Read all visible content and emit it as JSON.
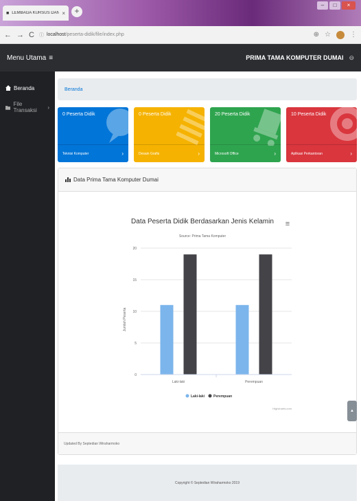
{
  "browser": {
    "tab_title": "LEMBAGA KURSUS DAN PELATI",
    "tab_close": "×",
    "new_tab": "+",
    "url_host": "localhost",
    "url_path": "/peserta-didik/file/index.php"
  },
  "header": {
    "menu_label": "Menu Utama",
    "menu_icon": "≡",
    "brand": "PRIMA TAMA KOMPUTER DUMAI",
    "user_icon": "⊖"
  },
  "sidebar": {
    "items": [
      {
        "label": "Beranda",
        "icon": "home-icon"
      },
      {
        "label": "File Transaksi",
        "icon": "folder-icon",
        "chevron": "›"
      }
    ]
  },
  "breadcrumb": {
    "label": "Beranda"
  },
  "cards": [
    {
      "count": "0 Peserta Didik",
      "foot": "Teknisi Komputer",
      "color": "#0275d8"
    },
    {
      "count": "0 Peserta Didik",
      "foot": "Desain Grafis",
      "color": "#f5b200"
    },
    {
      "count": "20 Peserta Didik",
      "foot": "Microsoft Office",
      "color": "#2fa44f"
    },
    {
      "count": "10 Peserta Didik",
      "foot": "Aplikasi Perkantoran",
      "color": "#d9363e"
    }
  ],
  "panel": {
    "title": "Data Prima Tama Komputer Dumai",
    "footer": "Updated By Septedian Wiraharmoko"
  },
  "chart_data": {
    "type": "bar",
    "title": "Data Peserta Didik Berdasarkan Jenis Kelamin",
    "subtitle": "Source: Prima Tama Komputer",
    "ylabel": "Jumlah Peserta",
    "categories": [
      "Laki-laki",
      "Perempuan"
    ],
    "ylim": [
      0,
      20
    ],
    "yticks": [
      0,
      5,
      10,
      15,
      20
    ],
    "series": [
      {
        "name": "Laki-laki",
        "color": "#7cb5ec",
        "values": [
          11,
          11
        ]
      },
      {
        "name": "Perempuan",
        "color": "#434348",
        "values": [
          19,
          19
        ]
      }
    ],
    "legend": "bottom-center",
    "credits": "Highcharts.com",
    "menu_icon": "≡"
  },
  "footer": {
    "copyright": "Copyright © Septedian Wiraharmoko 2019"
  },
  "scroll_top": "▲"
}
